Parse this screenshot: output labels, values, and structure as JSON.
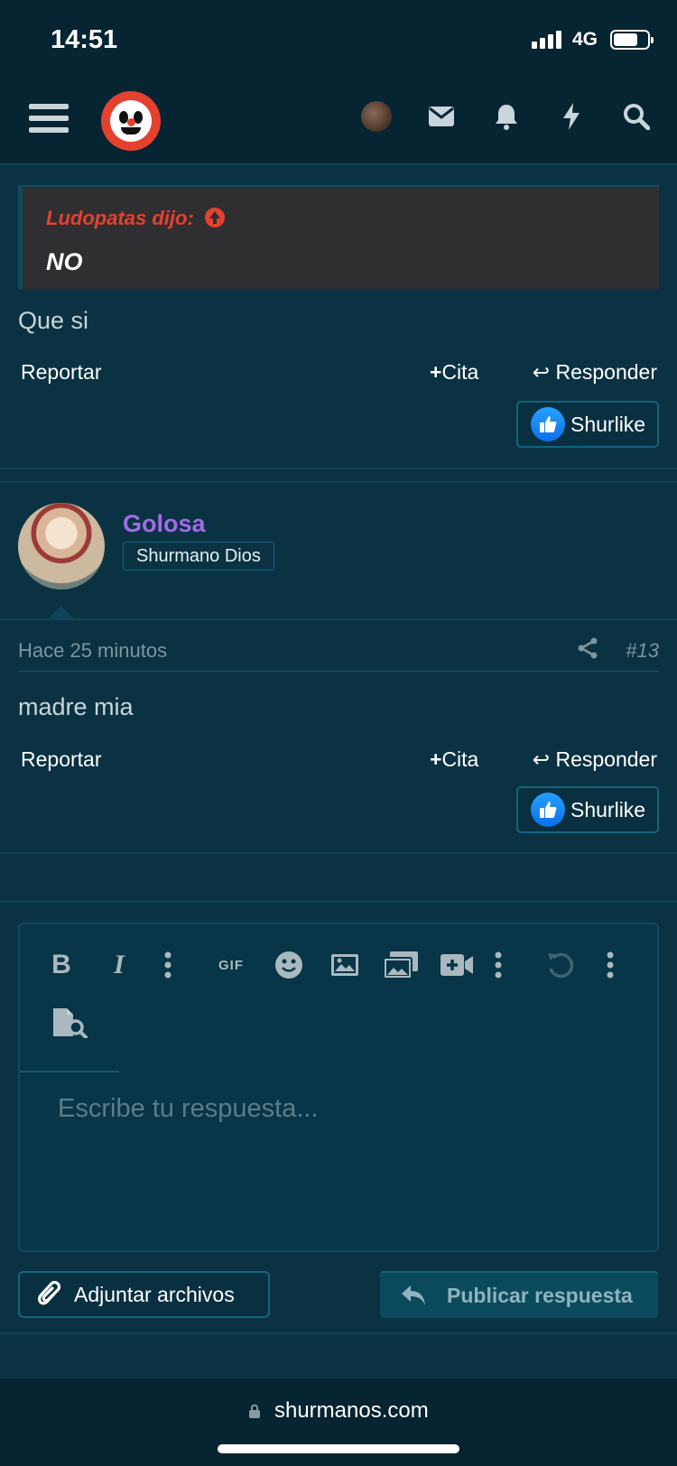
{
  "status_bar": {
    "time": "14:51",
    "network": "4G"
  },
  "post1": {
    "quote_author": "Ludopatas dijo:",
    "quote_text": "NO",
    "body": "Que si",
    "actions": {
      "report": "Reportar",
      "quote": "Cita",
      "reply": "Responder"
    },
    "like": "Shurlike"
  },
  "post2": {
    "username": "Golosa",
    "user_title": "Shurmano Dios",
    "time": "Hace 25 minutos",
    "post_number": "#13",
    "body": "madre mia",
    "actions": {
      "report": "Reportar",
      "quote": "Cita",
      "reply": "Responder"
    },
    "like": "Shurlike"
  },
  "editor": {
    "placeholder": "Escribe tu respuesta...",
    "gif_label": "GIF",
    "attach_label": "Adjuntar archivos",
    "publish_label": "Publicar respuesta"
  },
  "browser": {
    "url": "shurmanos.com"
  },
  "colors": {
    "background": "#0a3243",
    "accent_red": "#e5412f",
    "username_purple": "#a26be6",
    "like_blue": "#1a8cff"
  }
}
